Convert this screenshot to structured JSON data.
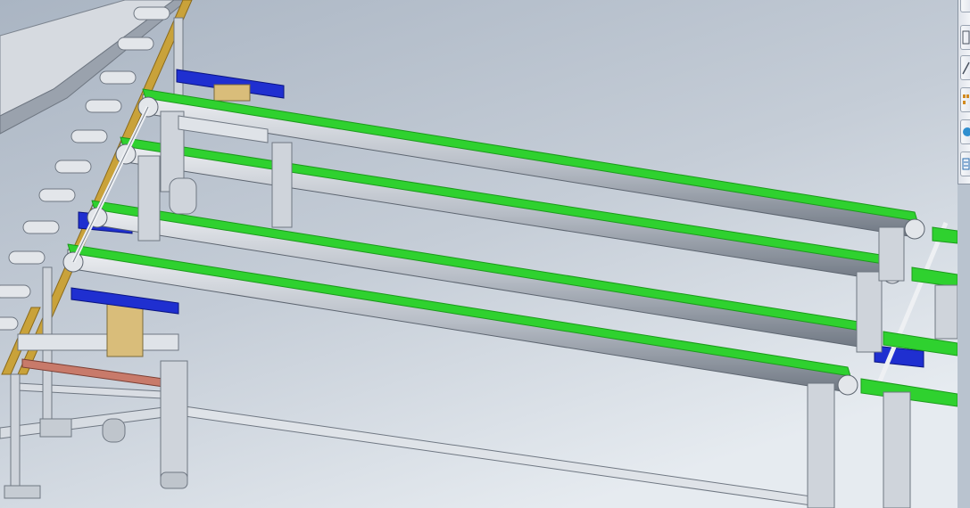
{
  "viewport": {
    "colors": {
      "background_top": "#aeb8c6",
      "background_bottom": "#dde3ea",
      "belt_green": "#2fd12f",
      "belt_green_dark": "#1c9a1c",
      "stop_blue": "#1f2fd0",
      "bracket_yellow": "#c9a23a",
      "steel": "#cfd4db",
      "steel_dark": "#6f7782",
      "pad_red": "#c87a6a"
    }
  },
  "taskpane": {
    "tabs": [
      {
        "name": "solidworks-resources-icon"
      },
      {
        "name": "design-library-icon"
      },
      {
        "name": "file-explorer-icon"
      },
      {
        "name": "view-palette-icon"
      },
      {
        "name": "appearances-icon"
      },
      {
        "name": "custom-properties-icon"
      }
    ]
  }
}
